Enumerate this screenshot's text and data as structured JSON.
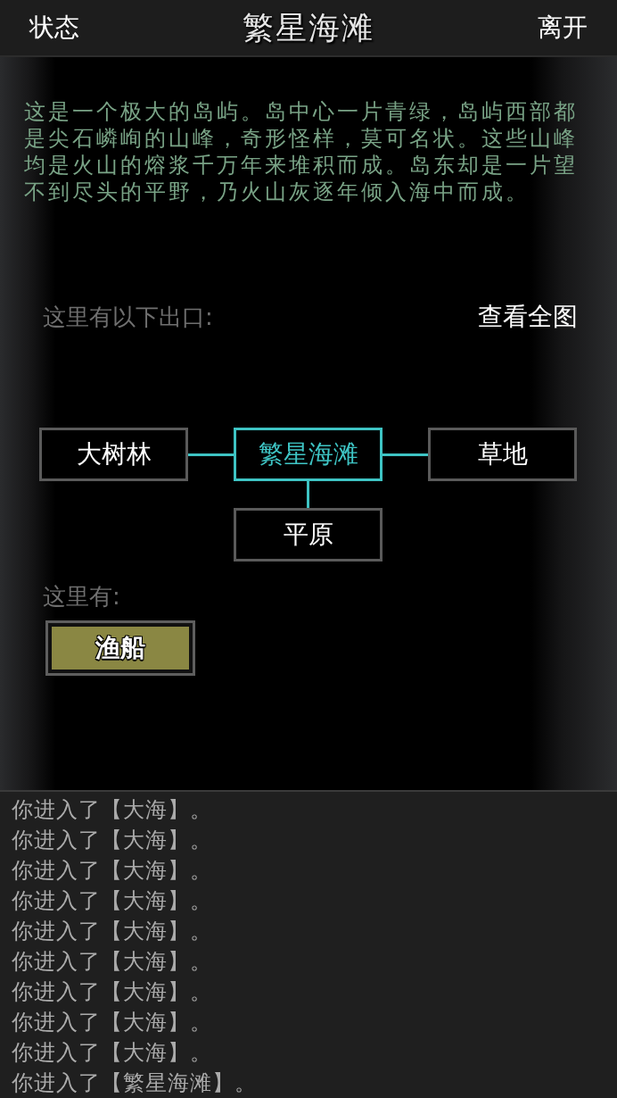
{
  "header": {
    "left_button": "状态",
    "title": "繁星海滩",
    "right_button": "离开"
  },
  "description": "这是一个极大的岛屿。岛中心一片青绿，岛屿西部都是尖石嶙峋的山峰，奇形怪样，莫可名状。这些山峰均是火山的熔浆千万年来堆积而成。岛东却是一片望不到尽头的平野，乃火山灰逐年倾入海中而成。",
  "exits": {
    "label": "这里有以下出口:",
    "map_button": "查看全图",
    "nodes": {
      "west": {
        "label": "大树林",
        "selected": false
      },
      "center": {
        "label": "繁星海滩",
        "selected": true
      },
      "east": {
        "label": "草地",
        "selected": false
      },
      "south": {
        "label": "平原",
        "selected": false
      }
    }
  },
  "here": {
    "label": "这里有:",
    "items": [
      {
        "label": "渔船"
      }
    ]
  },
  "log": [
    "你进入了【大海】。",
    "你进入了【大海】。",
    "你进入了【大海】。",
    "你进入了【大海】。",
    "你进入了【大海】。",
    "你进入了【大海】。",
    "你进入了【大海】。",
    "你进入了【大海】。",
    "你进入了【大海】。",
    "你进入了【繁星海滩】。"
  ]
}
